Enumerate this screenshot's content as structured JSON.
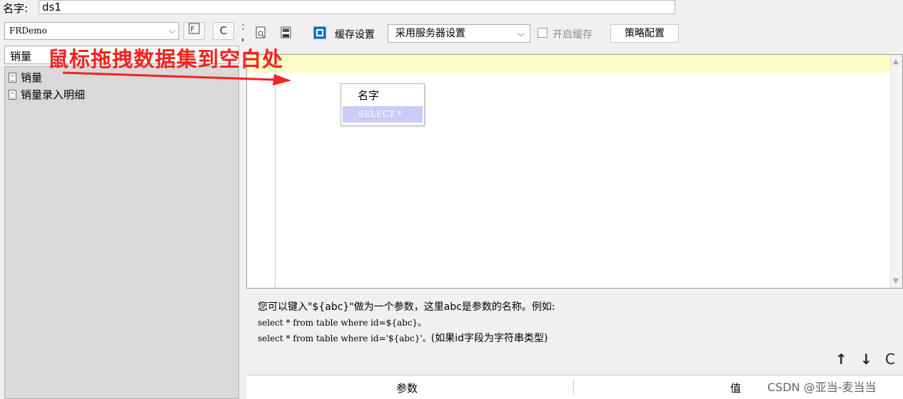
{
  "name_row": {
    "label": "名字:",
    "value": "ds1"
  },
  "left": {
    "datasource": "FRDemo",
    "search_text": "销量",
    "tree_items": [
      "销量",
      "销量录入明细"
    ]
  },
  "toolbar": {
    "cache_settings_label": "缓存设置",
    "cache_select_value": "采用服务器设置",
    "enable_cache_label": "开启缓存",
    "policy_button": "策略配置"
  },
  "popup": {
    "header": "名字",
    "selected_row": "SELECT *"
  },
  "hint": {
    "line1": "您可以键入\"${abc}\"做为一个参数，这里abc是参数的名称。例如:",
    "line2": "select * from table where id=${abc}。",
    "line3_code": "select * from table where id='${abc}'。",
    "line3_suffix": "(如果id字段为字符串类型)"
  },
  "param_table": {
    "col_param": "参数",
    "col_value": "值"
  },
  "annotation": {
    "text": "鼠标拖拽数据集到空白处",
    "color": "#f3231e"
  },
  "watermark": "CSDN @亚当-麦当当",
  "icons": {
    "dropdown": "chevron-down-icon",
    "formula": "formula-icon",
    "refresh": "refresh-icon",
    "preview": "preview-icon",
    "save": "save-sql-icon",
    "cache": "cache-icon",
    "up": "arrow-up-icon",
    "down": "arrow-down-icon"
  },
  "glyphs": {
    "chevron": "⌵",
    "refresh": "C",
    "formula": "F",
    "up": "↑",
    "down": "↓",
    "reload": "C",
    "scroll_up": "▲",
    "scroll_down": "▼"
  }
}
